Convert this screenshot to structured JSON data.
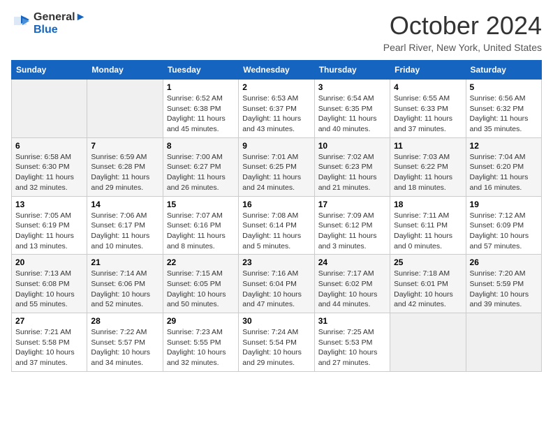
{
  "header": {
    "logo_line1": "General",
    "logo_line2": "Blue",
    "month": "October 2024",
    "location": "Pearl River, New York, United States"
  },
  "weekdays": [
    "Sunday",
    "Monday",
    "Tuesday",
    "Wednesday",
    "Thursday",
    "Friday",
    "Saturday"
  ],
  "weeks": [
    [
      {
        "day": "",
        "info": ""
      },
      {
        "day": "",
        "info": ""
      },
      {
        "day": "1",
        "info": "Sunrise: 6:52 AM\nSunset: 6:38 PM\nDaylight: 11 hours and 45 minutes."
      },
      {
        "day": "2",
        "info": "Sunrise: 6:53 AM\nSunset: 6:37 PM\nDaylight: 11 hours and 43 minutes."
      },
      {
        "day": "3",
        "info": "Sunrise: 6:54 AM\nSunset: 6:35 PM\nDaylight: 11 hours and 40 minutes."
      },
      {
        "day": "4",
        "info": "Sunrise: 6:55 AM\nSunset: 6:33 PM\nDaylight: 11 hours and 37 minutes."
      },
      {
        "day": "5",
        "info": "Sunrise: 6:56 AM\nSunset: 6:32 PM\nDaylight: 11 hours and 35 minutes."
      }
    ],
    [
      {
        "day": "6",
        "info": "Sunrise: 6:58 AM\nSunset: 6:30 PM\nDaylight: 11 hours and 32 minutes."
      },
      {
        "day": "7",
        "info": "Sunrise: 6:59 AM\nSunset: 6:28 PM\nDaylight: 11 hours and 29 minutes."
      },
      {
        "day": "8",
        "info": "Sunrise: 7:00 AM\nSunset: 6:27 PM\nDaylight: 11 hours and 26 minutes."
      },
      {
        "day": "9",
        "info": "Sunrise: 7:01 AM\nSunset: 6:25 PM\nDaylight: 11 hours and 24 minutes."
      },
      {
        "day": "10",
        "info": "Sunrise: 7:02 AM\nSunset: 6:23 PM\nDaylight: 11 hours and 21 minutes."
      },
      {
        "day": "11",
        "info": "Sunrise: 7:03 AM\nSunset: 6:22 PM\nDaylight: 11 hours and 18 minutes."
      },
      {
        "day": "12",
        "info": "Sunrise: 7:04 AM\nSunset: 6:20 PM\nDaylight: 11 hours and 16 minutes."
      }
    ],
    [
      {
        "day": "13",
        "info": "Sunrise: 7:05 AM\nSunset: 6:19 PM\nDaylight: 11 hours and 13 minutes."
      },
      {
        "day": "14",
        "info": "Sunrise: 7:06 AM\nSunset: 6:17 PM\nDaylight: 11 hours and 10 minutes."
      },
      {
        "day": "15",
        "info": "Sunrise: 7:07 AM\nSunset: 6:16 PM\nDaylight: 11 hours and 8 minutes."
      },
      {
        "day": "16",
        "info": "Sunrise: 7:08 AM\nSunset: 6:14 PM\nDaylight: 11 hours and 5 minutes."
      },
      {
        "day": "17",
        "info": "Sunrise: 7:09 AM\nSunset: 6:12 PM\nDaylight: 11 hours and 3 minutes."
      },
      {
        "day": "18",
        "info": "Sunrise: 7:11 AM\nSunset: 6:11 PM\nDaylight: 11 hours and 0 minutes."
      },
      {
        "day": "19",
        "info": "Sunrise: 7:12 AM\nSunset: 6:09 PM\nDaylight: 10 hours and 57 minutes."
      }
    ],
    [
      {
        "day": "20",
        "info": "Sunrise: 7:13 AM\nSunset: 6:08 PM\nDaylight: 10 hours and 55 minutes."
      },
      {
        "day": "21",
        "info": "Sunrise: 7:14 AM\nSunset: 6:06 PM\nDaylight: 10 hours and 52 minutes."
      },
      {
        "day": "22",
        "info": "Sunrise: 7:15 AM\nSunset: 6:05 PM\nDaylight: 10 hours and 50 minutes."
      },
      {
        "day": "23",
        "info": "Sunrise: 7:16 AM\nSunset: 6:04 PM\nDaylight: 10 hours and 47 minutes."
      },
      {
        "day": "24",
        "info": "Sunrise: 7:17 AM\nSunset: 6:02 PM\nDaylight: 10 hours and 44 minutes."
      },
      {
        "day": "25",
        "info": "Sunrise: 7:18 AM\nSunset: 6:01 PM\nDaylight: 10 hours and 42 minutes."
      },
      {
        "day": "26",
        "info": "Sunrise: 7:20 AM\nSunset: 5:59 PM\nDaylight: 10 hours and 39 minutes."
      }
    ],
    [
      {
        "day": "27",
        "info": "Sunrise: 7:21 AM\nSunset: 5:58 PM\nDaylight: 10 hours and 37 minutes."
      },
      {
        "day": "28",
        "info": "Sunrise: 7:22 AM\nSunset: 5:57 PM\nDaylight: 10 hours and 34 minutes."
      },
      {
        "day": "29",
        "info": "Sunrise: 7:23 AM\nSunset: 5:55 PM\nDaylight: 10 hours and 32 minutes."
      },
      {
        "day": "30",
        "info": "Sunrise: 7:24 AM\nSunset: 5:54 PM\nDaylight: 10 hours and 29 minutes."
      },
      {
        "day": "31",
        "info": "Sunrise: 7:25 AM\nSunset: 5:53 PM\nDaylight: 10 hours and 27 minutes."
      },
      {
        "day": "",
        "info": ""
      },
      {
        "day": "",
        "info": ""
      }
    ]
  ]
}
